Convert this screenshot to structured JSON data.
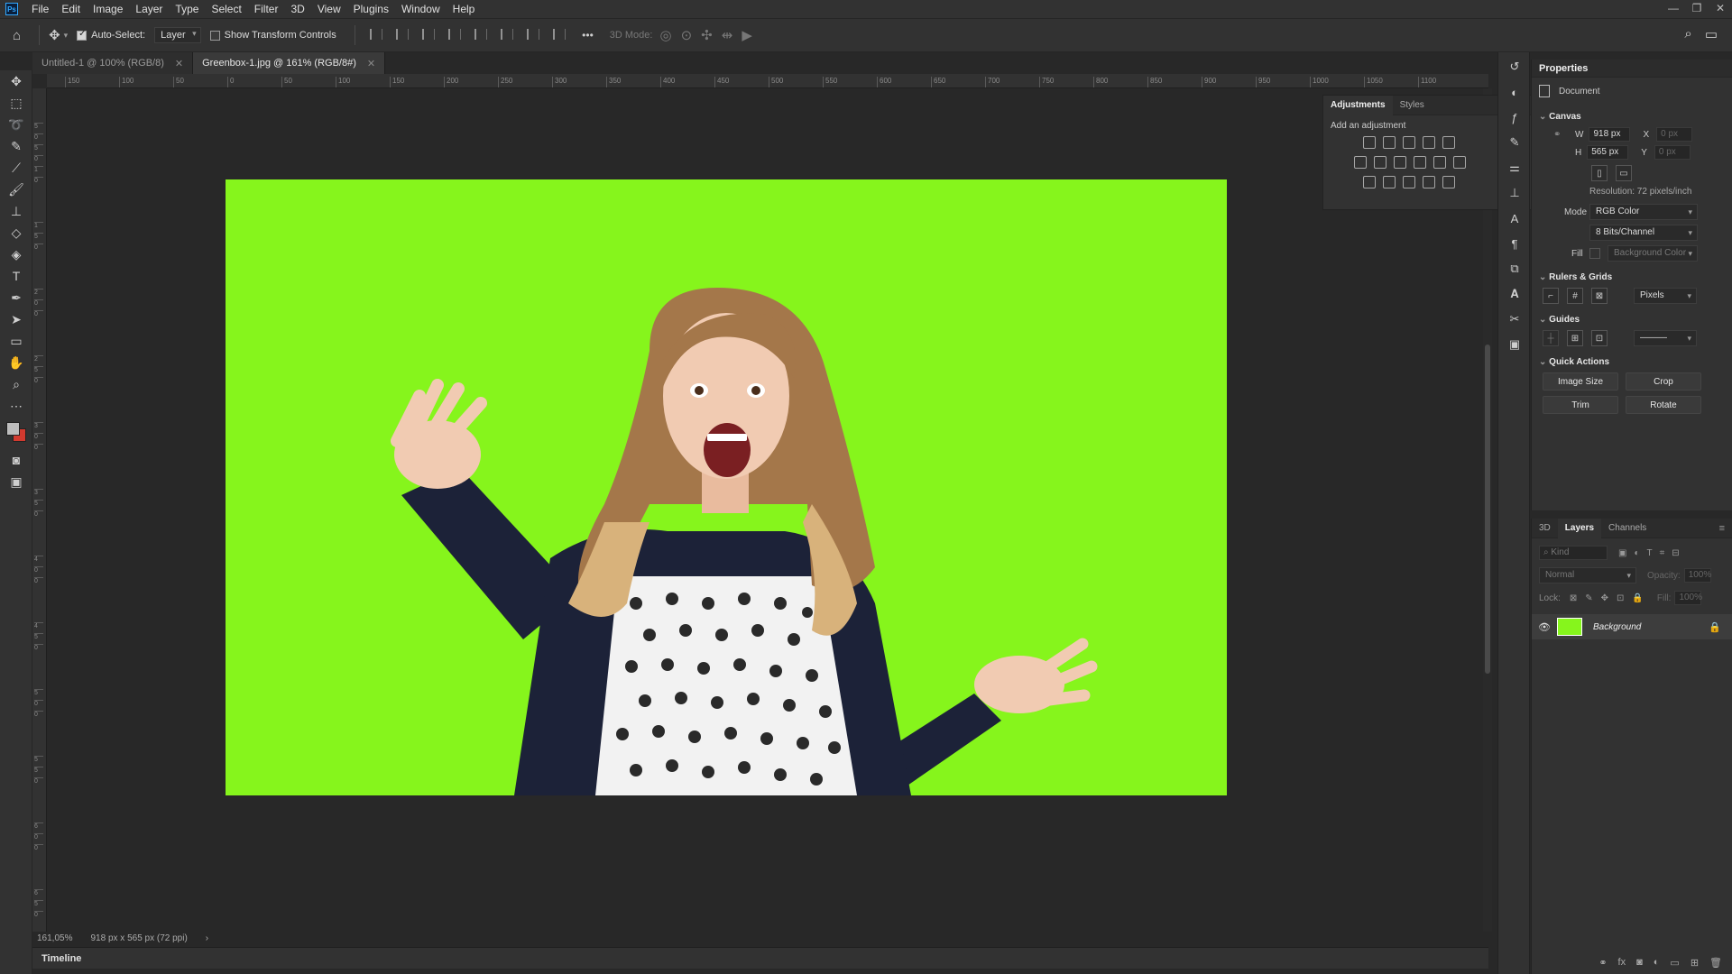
{
  "menubar": {
    "logo": "Ps",
    "items": [
      "File",
      "Edit",
      "Image",
      "Layer",
      "Type",
      "Select",
      "Filter",
      "3D",
      "View",
      "Plugins",
      "Window",
      "Help"
    ],
    "window_controls": [
      "—",
      "❐",
      "✕"
    ]
  },
  "options": {
    "auto_select_label": "Auto-Select:",
    "auto_select_checked": true,
    "target": "Layer",
    "transform_label": "Show Transform Controls",
    "mode_3d": "3D Mode:",
    "more": "•••"
  },
  "tabs": [
    {
      "label": "Untitled-1 @ 100% (RGB/8)",
      "active": false
    },
    {
      "label": "Greenbox-1.jpg @ 161% (RGB/8#)",
      "active": true
    }
  ],
  "ruler_top": [
    "150",
    "100",
    "50",
    "0",
    "50",
    "100",
    "150",
    "200",
    "250",
    "300",
    "350",
    "400",
    "450",
    "500",
    "550",
    "600",
    "650",
    "700",
    "750",
    "800",
    "850",
    "900",
    "950",
    "1000",
    "1050",
    "1100"
  ],
  "ruler_left": [
    "5",
    "0",
    "5",
    "0",
    "1",
    "0",
    "1",
    "5",
    "0",
    "2",
    "0",
    "0",
    "2",
    "5",
    "0",
    "3",
    "0",
    "0",
    "3",
    "5",
    "0",
    "4",
    "0",
    "0",
    "4",
    "5",
    "0",
    "5",
    "0",
    "0",
    "5",
    "5",
    "0",
    "6",
    "0",
    "0",
    "6",
    "5",
    "0"
  ],
  "status": {
    "zoom": "161,05%",
    "doc_info": "918 px x 565 px (72 ppi)"
  },
  "timeline": "Timeline",
  "adjustments": {
    "tabs": [
      "Adjustments",
      "Styles"
    ],
    "label": "Add an adjustment"
  },
  "properties": {
    "title": "Properties",
    "document_label": "Document",
    "canvas": {
      "title": "Canvas",
      "w_label": "W",
      "w_value": "918 px",
      "h_label": "H",
      "h_value": "565 px",
      "x_label": "X",
      "x_value": "0 px",
      "y_label": "Y",
      "y_value": "0 px",
      "resolution": "Resolution: 72 pixels/inch",
      "mode_label": "Mode",
      "mode_value": "RGB Color",
      "depth_value": "8 Bits/Channel",
      "fill_label": "Fill",
      "fill_value": "Background Color"
    },
    "rulers": {
      "title": "Rulers & Grids",
      "units": "Pixels"
    },
    "guides": {
      "title": "Guides"
    },
    "quick_actions": {
      "title": "Quick Actions",
      "image_size": "Image Size",
      "crop": "Crop",
      "trim": "Trim",
      "rotate": "Rotate"
    }
  },
  "layers": {
    "tabs": [
      "3D",
      "Layers",
      "Channels"
    ],
    "filter_placeholder": "Kind",
    "blend_mode": "Normal",
    "opacity_label": "Opacity:",
    "opacity_value": "100%",
    "lock_label": "Lock:",
    "fill_label": "Fill:",
    "fill_value": "100%",
    "layer_name": "Background"
  },
  "colors": {
    "green_screen": "#86f51c",
    "foreground": "#bdbdbd",
    "background": "#d23a2f"
  }
}
